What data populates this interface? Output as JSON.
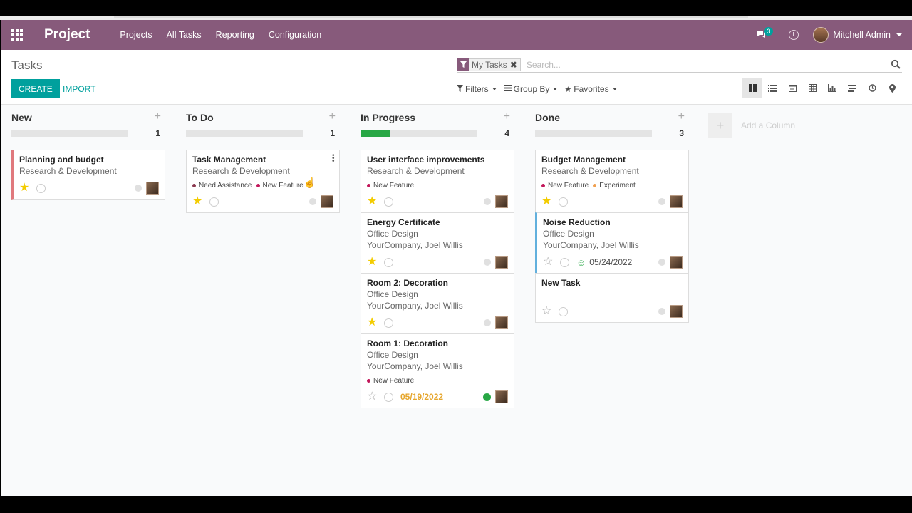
{
  "navbar": {
    "app_title": "Project",
    "menu": [
      "Projects",
      "All Tasks",
      "Reporting",
      "Configuration"
    ],
    "messages_count": "3",
    "user_name": "Mitchell Admin",
    "color": "#875a7b"
  },
  "control": {
    "breadcrumb": "Tasks",
    "facet_label": "My Tasks",
    "search_placeholder": "Search...",
    "create_label": "CREATE",
    "import_label": "IMPORT",
    "filters_label": "Filters",
    "groupby_label": "Group By",
    "favorites_label": "Favorites",
    "accent": "#00a09d"
  },
  "columns": [
    {
      "title": "New",
      "count": "1",
      "progress": 0,
      "cards": [
        {
          "title": "Planning and budget",
          "lines": [
            "Research & Development"
          ],
          "tags": [],
          "starred": true,
          "state": "normal",
          "bar": "red"
        }
      ]
    },
    {
      "title": "To Do",
      "count": "1",
      "progress": 0,
      "cards": [
        {
          "title": "Task Management",
          "lines": [
            "Research & Development"
          ],
          "tags": [
            {
              "label": "Need Assistance",
              "color": "#8b3a50"
            },
            {
              "label": "New Feature",
              "color": "#c2185b"
            }
          ],
          "starred": true,
          "state": "normal",
          "bar": ""
        }
      ]
    },
    {
      "title": "In Progress",
      "count": "4",
      "progress": 0.25,
      "cards": [
        {
          "title": "User interface improvements",
          "lines": [
            "Research & Development"
          ],
          "tags": [
            {
              "label": "New Feature",
              "color": "#c2185b"
            }
          ],
          "starred": true,
          "state": "normal",
          "bar": ""
        },
        {
          "title": "Energy Certificate",
          "lines": [
            "Office Design",
            "YourCompany, Joel Willis"
          ],
          "tags": [],
          "starred": true,
          "state": "normal",
          "bar": ""
        },
        {
          "title": "Room 2: Decoration",
          "lines": [
            "Office Design",
            "YourCompany, Joel Willis"
          ],
          "tags": [],
          "starred": true,
          "state": "normal",
          "bar": ""
        },
        {
          "title": "Room 1: Decoration",
          "lines": [
            "Office Design",
            "YourCompany, Joel Willis"
          ],
          "tags": [
            {
              "label": "New Feature",
              "color": "#c2185b"
            }
          ],
          "starred": false,
          "state": "done",
          "bar": "",
          "deadline": "05/19/2022",
          "deadline_style": "orange"
        }
      ]
    },
    {
      "title": "Done",
      "count": "3",
      "progress": 0,
      "cards": [
        {
          "title": "Budget Management",
          "lines": [
            "Research & Development"
          ],
          "tags": [
            {
              "label": "New Feature",
              "color": "#c2185b"
            },
            {
              "label": "Experiment",
              "color": "#f0a050"
            }
          ],
          "starred": true,
          "state": "normal",
          "bar": ""
        },
        {
          "title": "Noise Reduction",
          "lines": [
            "Office Design",
            "YourCompany, Joel Willis"
          ],
          "tags": [],
          "starred": false,
          "state": "normal",
          "bar": "blue",
          "deadline": "05/24/2022",
          "deadline_style": "smile"
        },
        {
          "title": "New Task",
          "lines": [
            ""
          ],
          "tags": [],
          "starred": false,
          "state": "normal",
          "bar": ""
        }
      ]
    }
  ],
  "add_column_label": "Add a Column"
}
